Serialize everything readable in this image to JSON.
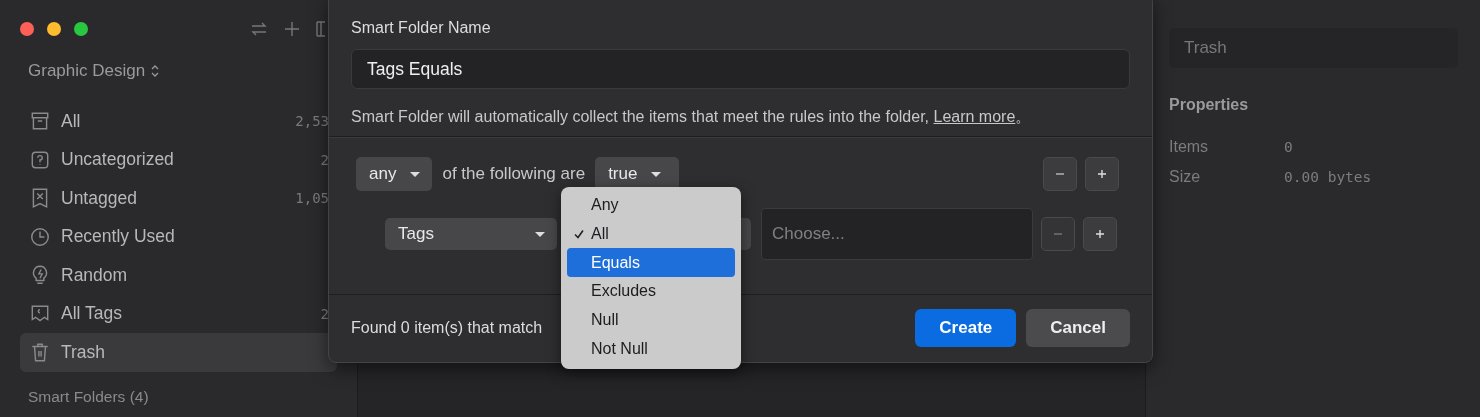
{
  "sidebar": {
    "library": "Graphic Design",
    "items": [
      {
        "label": "All",
        "count": "2,53",
        "selected": false
      },
      {
        "label": "Uncategorized",
        "count": "2",
        "selected": false
      },
      {
        "label": "Untagged",
        "count": "1,05",
        "selected": false
      },
      {
        "label": "Recently Used",
        "selected": false
      },
      {
        "label": "Random",
        "selected": false
      },
      {
        "label": "All Tags",
        "count": "2",
        "selected": false
      },
      {
        "label": "Trash",
        "selected": true
      }
    ],
    "section": "Smart Folders (4)"
  },
  "dialog": {
    "name_label": "Smart Folder Name",
    "name_value": "Tags Equals",
    "description": "Smart Folder will automatically collect the items that meet the rules into the folder, ",
    "link": "Learn more",
    "link_end": "。",
    "rule": {
      "match": "any",
      "text": "of the following are",
      "condition": "true"
    },
    "conditions": [
      {
        "field": "Tags",
        "value_placeholder": "Choose..."
      }
    ],
    "found": "Found 0 item(s) that match",
    "buttons": [
      {
        "label": "Create",
        "kind": "primary"
      },
      {
        "label": "Cancel",
        "kind": "secondary"
      }
    ],
    "menu": [
      {
        "label": "Any",
        "checked": false,
        "selected": false
      },
      {
        "label": "All",
        "checked": true,
        "selected": false
      },
      {
        "label": "Equals",
        "checked": false,
        "selected": true
      },
      {
        "label": "Excludes",
        "checked": false,
        "selected": false
      },
      {
        "label": "Null",
        "checked": false,
        "selected": false
      },
      {
        "label": "Not Null",
        "checked": false,
        "selected": false
      }
    ]
  },
  "inspector": {
    "name": "Trash",
    "heading": "Properties",
    "properties": [
      {
        "label": "Items",
        "value": "0"
      },
      {
        "label": "Size",
        "value": "0.00 bytes"
      }
    ]
  }
}
